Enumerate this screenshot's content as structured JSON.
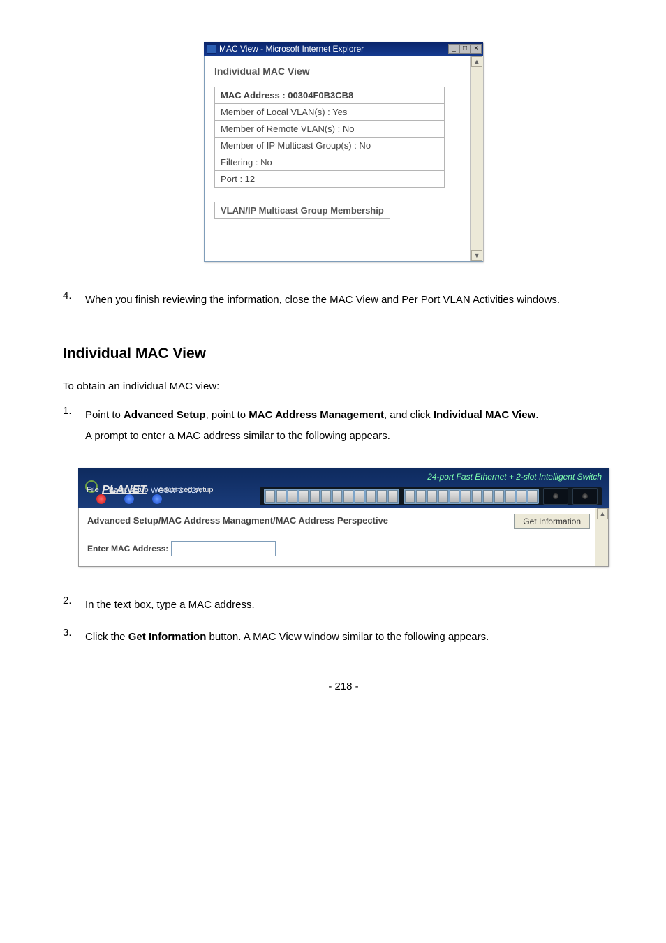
{
  "shot1": {
    "window_title": "MAC View - Microsoft Internet Explorer",
    "section_title": "Individual MAC View",
    "rows": {
      "mac_addr": "MAC Address : 00304F0B3CB8",
      "local_vlan": "Member of Local VLAN(s) : Yes",
      "remote_vlan": "Member of Remote VLAN(s) : No",
      "ip_multicast": "Member of IP Multicast Group(s) : No",
      "filtering": "Filtering : No",
      "port": "Port : 12"
    },
    "section_title2": "VLAN/IP Multicast Group Membership"
  },
  "para1_num": "4.",
  "para1": "When you finish reviewing the information, close the MAC View and Per Port VLAN Activities windows.",
  "heading": "Individual MAC View",
  "sub": "To obtain an individual MAC view:",
  "step1": {
    "num": "1.",
    "t1": "Point to ",
    "b1": "Advanced Setup",
    "t2": ", point to ",
    "b2": "MAC Address Management",
    "t3": ", and click ",
    "b3": "Individual MAC View",
    "t4": ".",
    "line2": "A prompt to enter a MAC address similar to the following appears."
  },
  "shot2": {
    "logo": "PLANET",
    "model": "WGSW-2402A",
    "right_text": "24-port Fast Ethernet + 2-slot Intelligent Switch",
    "menu_file": "File",
    "menu_basic": "Basic setup",
    "menu_adv": "Advanced setup",
    "breadcrumb": "Advanced Setup/MAC Address Managment/MAC Address Perspective",
    "button": "Get Information",
    "label": "Enter MAC Address:"
  },
  "step2": {
    "num": "2.",
    "text": "In the text box, type a MAC address."
  },
  "step3": {
    "num": "3.",
    "t1": "Click the ",
    "b1": "Get Information",
    "t2": " button. A MAC View window similar to the following appears."
  },
  "page_number": "- 218 -"
}
